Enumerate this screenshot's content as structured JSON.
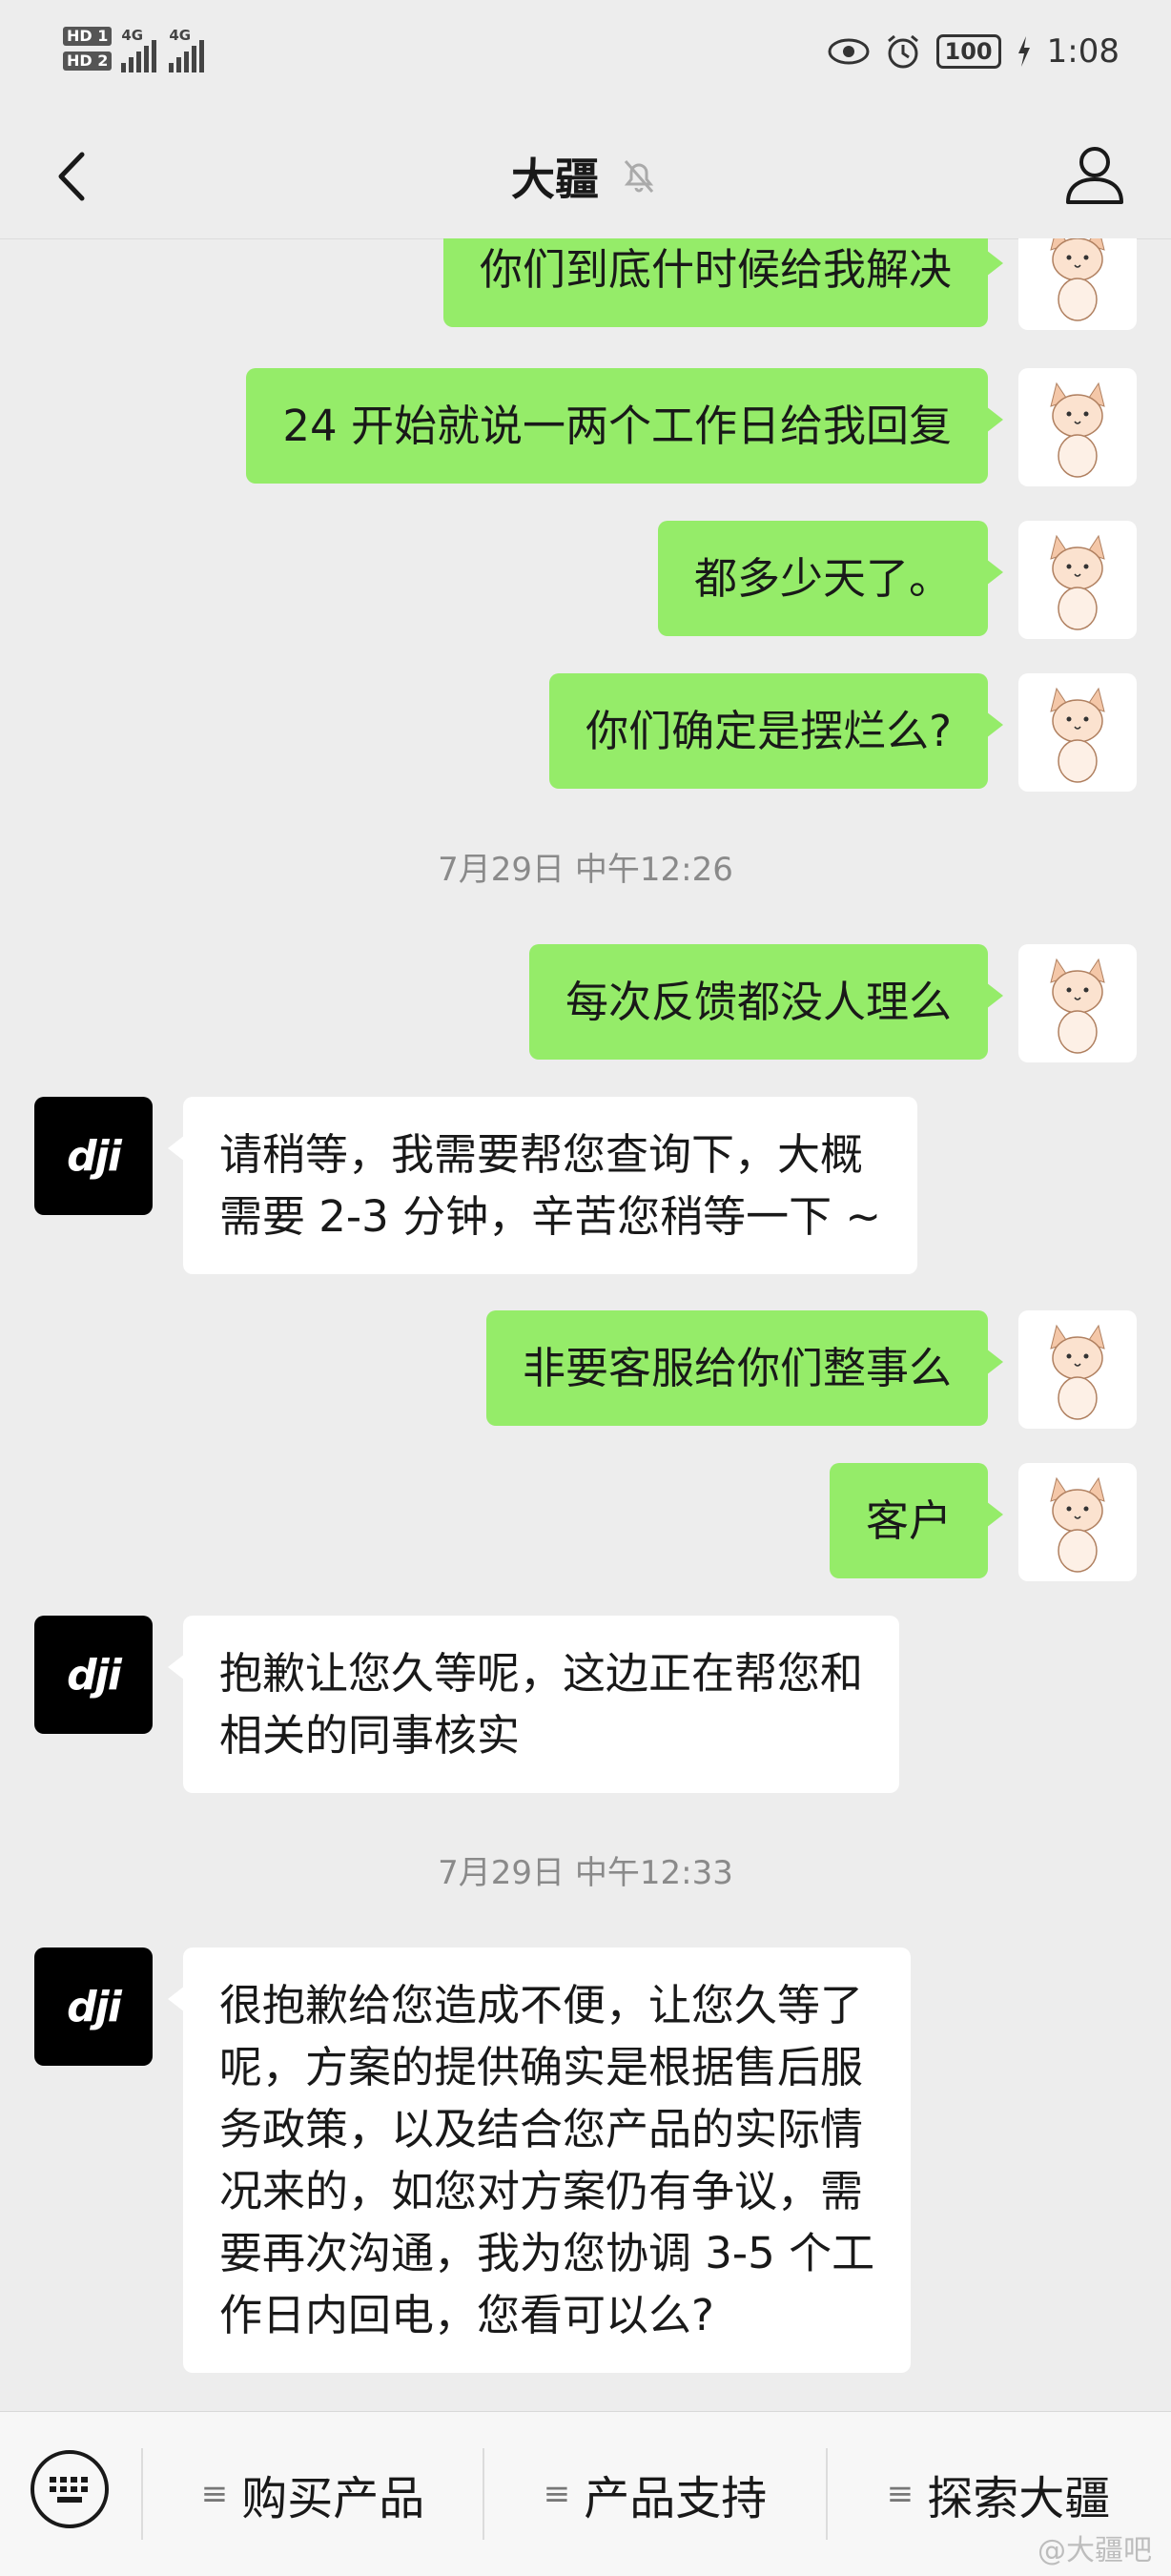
{
  "status_bar": {
    "hd1": "HD 1",
    "hd2": "HD 2",
    "net1": "4G",
    "net2": "4G",
    "battery": "100",
    "time": "1:08"
  },
  "header": {
    "title": "大疆"
  },
  "messages": [
    {
      "side": "me",
      "text": "你们到底什时候给我解决"
    },
    {
      "side": "me",
      "text": "24 开始就说一两个工作日给我回复"
    },
    {
      "side": "me",
      "text": "都多少天了。"
    },
    {
      "side": "me",
      "text": "你们确定是摆烂么?"
    },
    {
      "time": "7月29日 中午12:26"
    },
    {
      "side": "me",
      "text": "每次反馈都没人理么"
    },
    {
      "side": "them",
      "text": "请稍等，我需要帮您查询下，大概\n需要 2-3 分钟，辛苦您稍等一下 ~"
    },
    {
      "side": "me",
      "text": "非要客服给你们整事么"
    },
    {
      "side": "me",
      "text": "客户"
    },
    {
      "side": "them",
      "text": "抱歉让您久等呢，这边正在帮您和\n相关的同事核实"
    },
    {
      "time": "7月29日 中午12:33"
    },
    {
      "side": "them",
      "text": "很抱歉给您造成不便，让您久等了\n呢，方案的提供确实是根据售后服\n务政策，以及结合您产品的实际情\n况来的，如您对方案仍有争议，需\n要再次沟通，我为您协调 3-5 个工\n作日内回电，您看可以么?"
    }
  ],
  "avatar_them_label": "dji",
  "bottom_menu": [
    {
      "label": "购买产品",
      "icon": "menu-lines-icon"
    },
    {
      "label": "产品支持",
      "icon": "menu-lines-icon"
    },
    {
      "label": "探索大疆",
      "icon": "menu-lines-icon"
    }
  ],
  "watermark": "@大疆吧"
}
